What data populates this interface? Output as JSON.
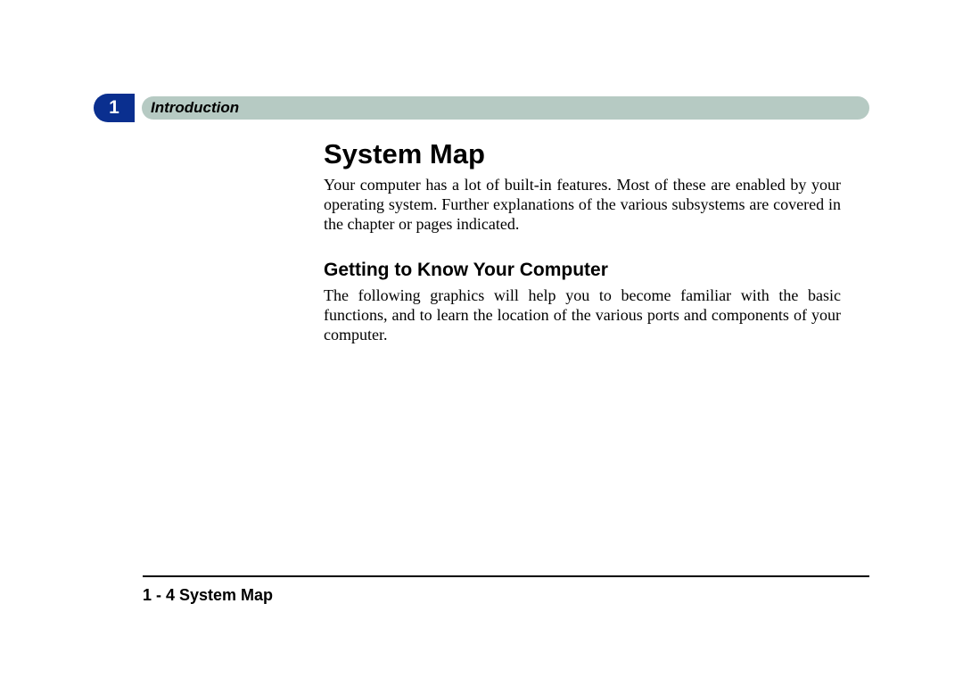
{
  "chapter_number": "1",
  "header_label": "Introduction",
  "title": "System Map",
  "paragraph1": "Your computer has a lot of built-in features. Most of these are enabled by your operating system. Further explanations of the various subsystems are covered in the chapter or pages indicated.",
  "subheading": "Getting to Know Your Computer",
  "paragraph2": "The following graphics will help you to become familiar with the basic functions, and to learn the location of the various ports and components of your computer.",
  "footer": "1 - 4  System Map"
}
